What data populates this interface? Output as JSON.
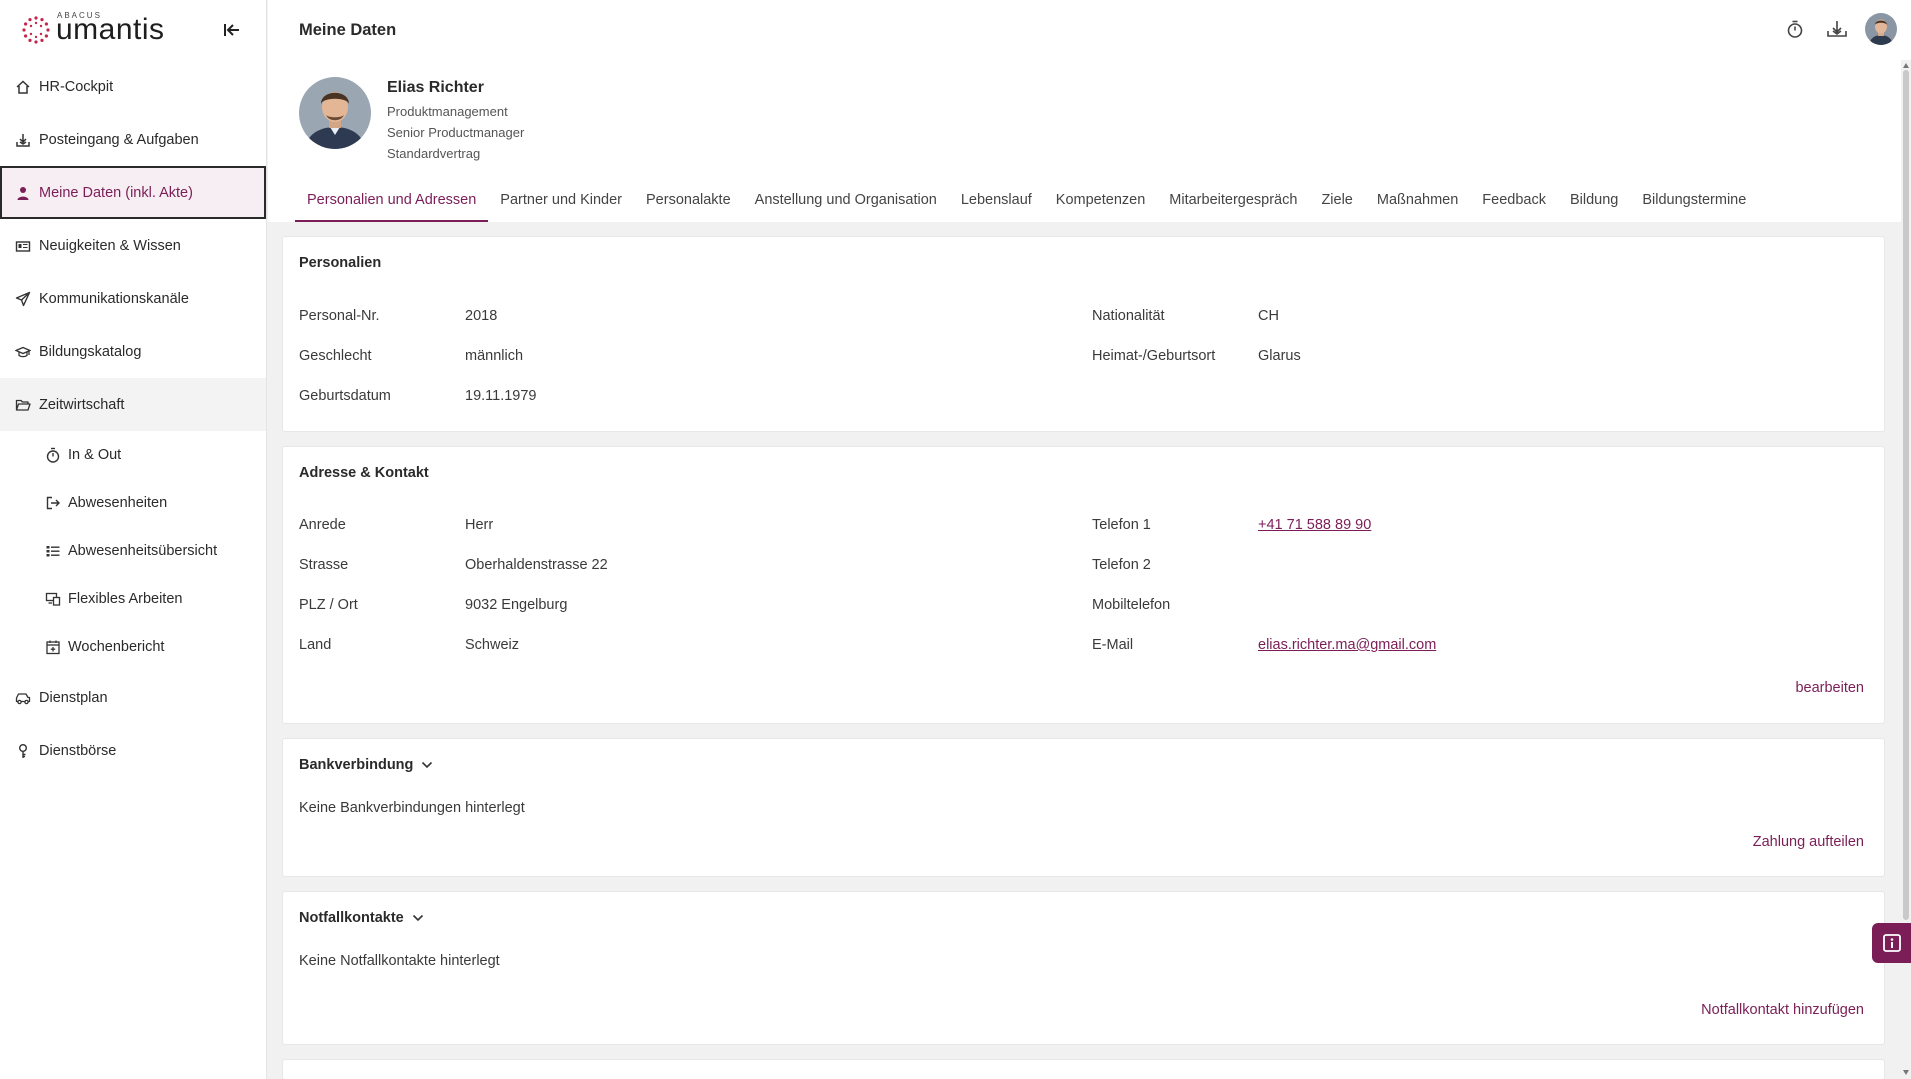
{
  "brand": {
    "small": "ABACUS",
    "big": "umantis",
    "accent_color": "#7b1e57",
    "logo_color": "#c4264b"
  },
  "sidebar": {
    "items": [
      {
        "label": "HR-Cockpit",
        "icon": "home-icon"
      },
      {
        "label": "Posteingang & Aufgaben",
        "icon": "inbox-icon"
      },
      {
        "label": "Meine Daten (inkl. Akte)",
        "icon": "person-icon",
        "active": true
      },
      {
        "label": "Neuigkeiten & Wissen",
        "icon": "news-icon"
      },
      {
        "label": "Kommunikationskanäle",
        "icon": "paper-plane-icon"
      },
      {
        "label": "Bildungskatalog",
        "icon": "graduation-cap-icon"
      },
      {
        "label": "Zeitwirtschaft",
        "icon": "folder-open-icon",
        "expanded": true
      }
    ],
    "subitems": [
      {
        "label": "In & Out",
        "icon": "stopwatch-icon"
      },
      {
        "label": "Abwesenheiten",
        "icon": "exit-icon"
      },
      {
        "label": "Abwesenheitsübersicht",
        "icon": "list-overview-icon"
      },
      {
        "label": "Flexibles Arbeiten",
        "icon": "devices-icon"
      },
      {
        "label": "Wochenbericht",
        "icon": "calendar-plus-icon"
      }
    ],
    "bottom_items": [
      {
        "label": "Dienstplan",
        "icon": "car-icon"
      },
      {
        "label": "Dienstbörse",
        "icon": "key-icon"
      }
    ]
  },
  "header": {
    "title": "Meine Daten"
  },
  "profile": {
    "name": "Elias Richter",
    "department": "Produktmanagement",
    "position": "Senior Productmanager",
    "contract": "Standardvertrag"
  },
  "tabs": [
    {
      "label": "Personalien und Adressen",
      "active": true
    },
    {
      "label": "Partner und Kinder"
    },
    {
      "label": "Personalakte"
    },
    {
      "label": "Anstellung und Organisation"
    },
    {
      "label": "Lebenslauf"
    },
    {
      "label": "Kompetenzen"
    },
    {
      "label": "Mitarbeitergespräch"
    },
    {
      "label": "Ziele"
    },
    {
      "label": "Maßnahmen"
    },
    {
      "label": "Feedback"
    },
    {
      "label": "Bildung"
    },
    {
      "label": "Bildungstermine"
    }
  ],
  "personalien": {
    "title": "Personalien",
    "left": [
      {
        "label": "Personal-Nr.",
        "value": "2018"
      },
      {
        "label": "Geschlecht",
        "value": "männlich"
      },
      {
        "label": "Geburtsdatum",
        "value": "19.11.1979"
      }
    ],
    "right": [
      {
        "label": "Nationalität",
        "value": "CH"
      },
      {
        "label": "Heimat-/Geburtsort",
        "value": "Glarus"
      }
    ]
  },
  "adresse": {
    "title": "Adresse & Kontakt",
    "left": [
      {
        "label": "Anrede",
        "value": "Herr"
      },
      {
        "label": "Strasse",
        "value": "Oberhaldenstrasse 22"
      },
      {
        "label": "PLZ / Ort",
        "value": "9032 Engelburg"
      },
      {
        "label": "Land",
        "value": "Schweiz"
      }
    ],
    "right": [
      {
        "label": "Telefon 1",
        "value": "+41 71 588 89 90",
        "link": true
      },
      {
        "label": "Telefon 2",
        "value": ""
      },
      {
        "label": "Mobiltelefon",
        "value": ""
      },
      {
        "label": "E-Mail",
        "value": "elias.richter.ma@gmail.com",
        "link": true
      }
    ],
    "action": "bearbeiten"
  },
  "bank": {
    "title": "Bankverbindung",
    "empty": "Keine Bankverbindungen hinterlegt",
    "action": "Zahlung aufteilen"
  },
  "notfall": {
    "title": "Notfallkontakte",
    "empty": "Keine Notfallkontakte hinterlegt",
    "action": "Notfallkontakt hinzufügen"
  }
}
